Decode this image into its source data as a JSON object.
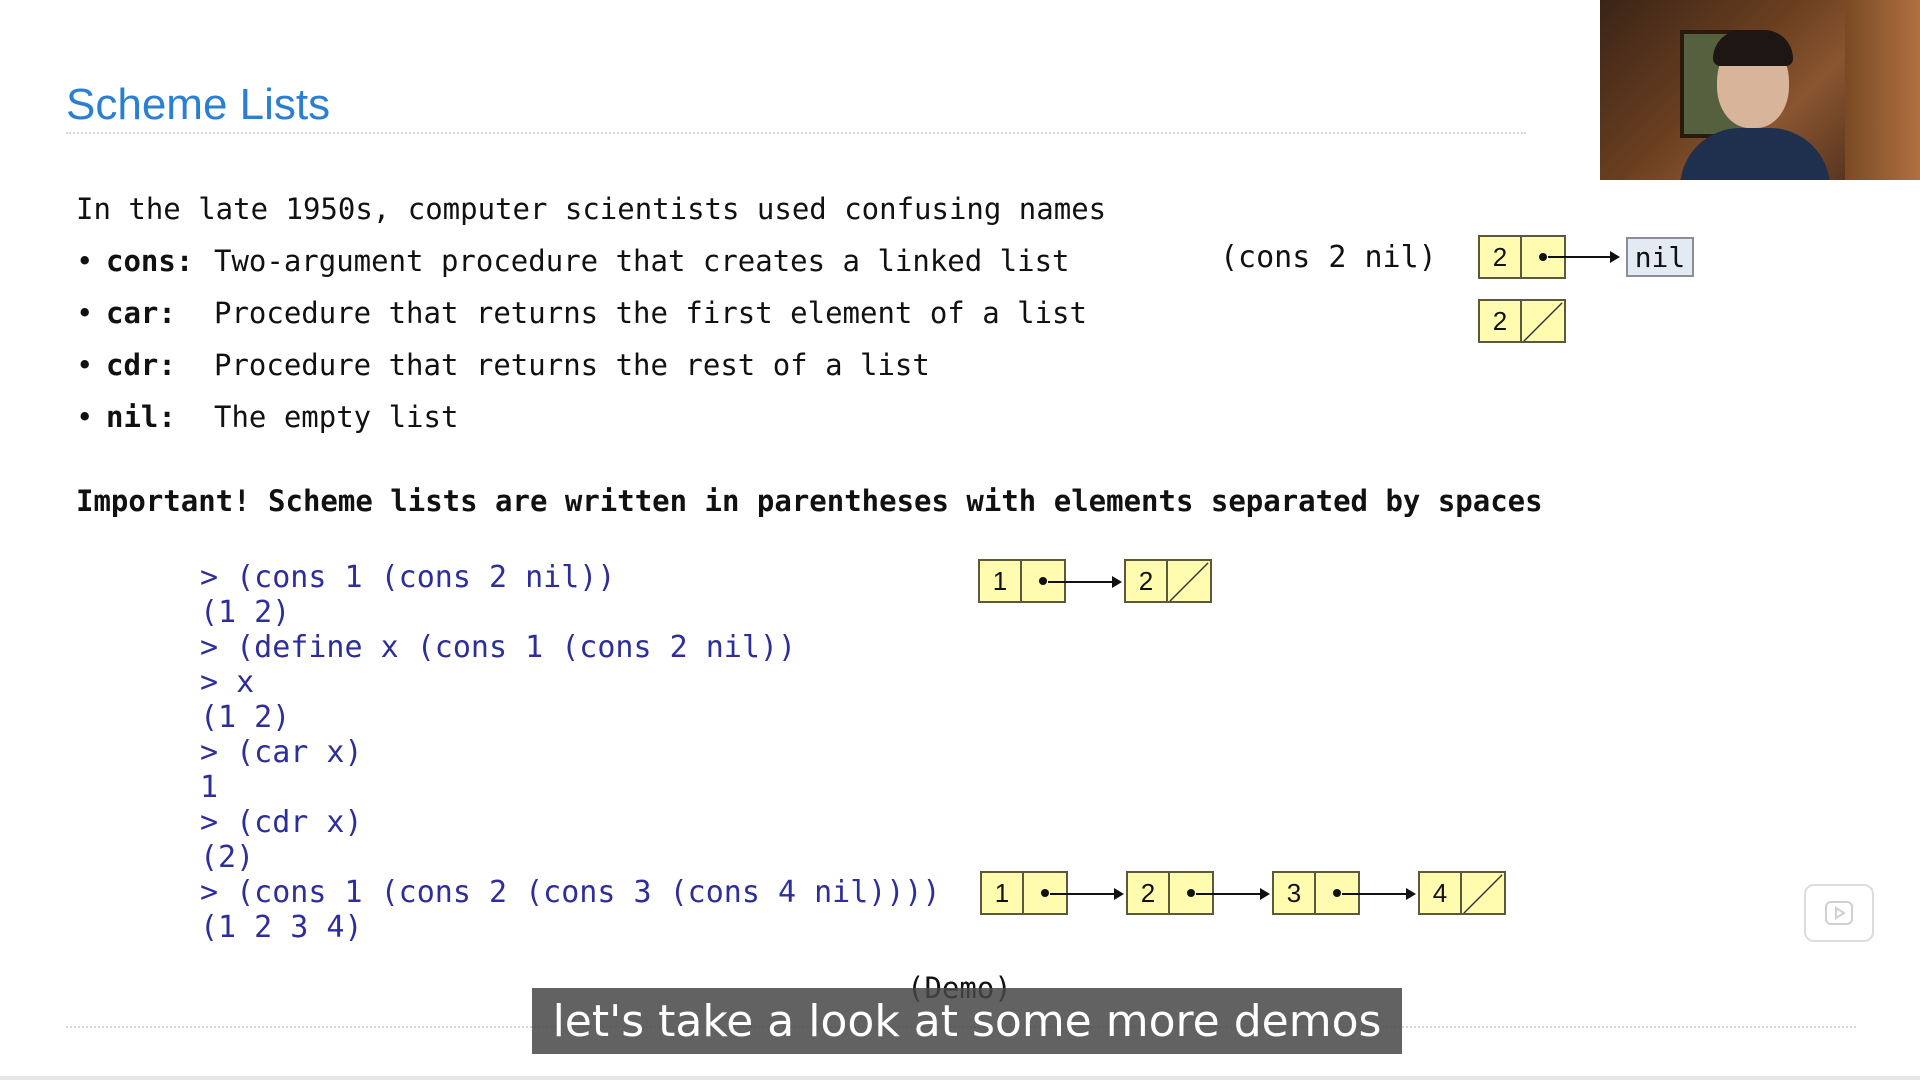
{
  "slide": {
    "title": "Scheme Lists",
    "intro": "In the late 1950s, computer scientists used confusing names",
    "bullets": [
      {
        "term": "cons:",
        "desc": "Two-argument procedure that creates a linked list"
      },
      {
        "term": "car:",
        "desc": "Procedure that returns the first element of a list"
      },
      {
        "term": "cdr:",
        "desc": "Procedure that returns the rest of a list"
      },
      {
        "term": "nil:",
        "desc": "The empty list"
      }
    ],
    "important": "Important! Scheme lists are written in parentheses with elements separated by spaces",
    "code_lines": [
      "> (cons 1 (cons 2 nil))",
      "(1 2)",
      "> (define x (cons 1 (cons 2 nil))",
      "> x",
      "(1 2)",
      "> (car x)",
      "1",
      "> (cdr x)",
      "(2)",
      "> (cons 1 (cons 2 (cons 3 (cons 4 nil))))",
      "(1 2 3 4)"
    ],
    "demo_note": "(Demo)"
  },
  "diagrams": {
    "cons_expr": "(cons 2 nil)",
    "nil_label": "nil",
    "pair_2_nil": [
      "2"
    ],
    "pair_2_empty": [
      "2"
    ],
    "list_1_2": [
      "1",
      "2"
    ],
    "list_1_2_3_4": [
      "1",
      "2",
      "3",
      "4"
    ]
  },
  "subtitle": "let's take a look at some more demos",
  "colors": {
    "title": "#2a7fd4",
    "code": "#2e2e9a",
    "cell_fill": "#fffcb0",
    "nil_fill": "#e4eaf3"
  },
  "icons": {
    "player": "play-icon"
  }
}
